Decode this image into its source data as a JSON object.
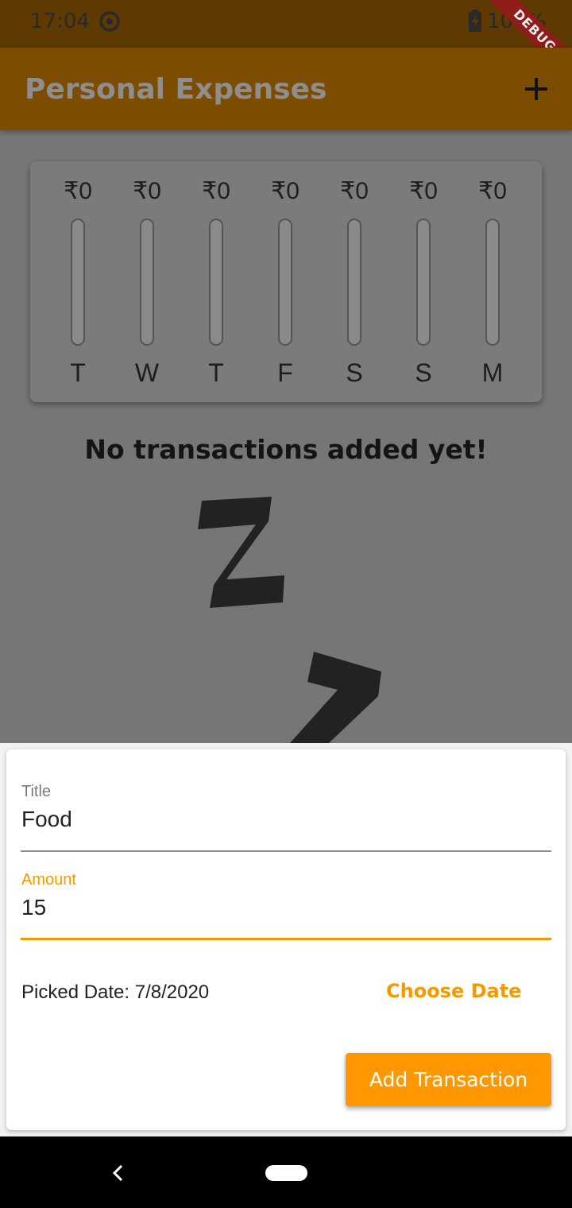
{
  "status_bar": {
    "time": "17:04",
    "battery": "100%"
  },
  "debug_banner": "DEBUG",
  "app_bar": {
    "title": "Personal Expenses",
    "add_icon": "plus-icon"
  },
  "chart": {
    "bars": [
      {
        "day": "T",
        "amount": "₹0",
        "fill_pct": 0
      },
      {
        "day": "W",
        "amount": "₹0",
        "fill_pct": 0
      },
      {
        "day": "T",
        "amount": "₹0",
        "fill_pct": 0
      },
      {
        "day": "F",
        "amount": "₹0",
        "fill_pct": 0
      },
      {
        "day": "S",
        "amount": "₹0",
        "fill_pct": 0
      },
      {
        "day": "S",
        "amount": "₹0",
        "fill_pct": 0
      },
      {
        "day": "M",
        "amount": "₹0",
        "fill_pct": 0
      }
    ]
  },
  "empty_state": {
    "text": "No transactions added yet!",
    "image_icon": "sleep-zz-icon"
  },
  "form": {
    "title_label": "Title",
    "title_value": "Food",
    "amount_label": "Amount",
    "amount_value": "15",
    "picked_date": "Picked Date: 7/8/2020",
    "choose_date_label": "Choose Date",
    "submit_label": "Add Transaction"
  },
  "colors": {
    "accent": "#ff9800",
    "app_bar": "#7c4d00",
    "status_bar": "#5e3a00"
  }
}
